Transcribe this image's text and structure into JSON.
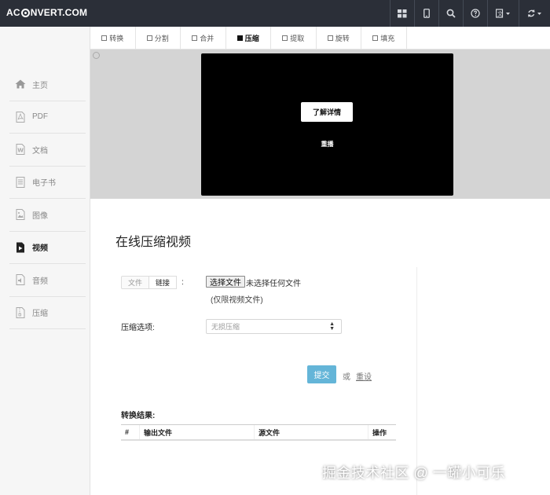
{
  "header": {
    "logo_left": "AC",
    "logo_right": "NVERT.COM"
  },
  "tabs": [
    {
      "label": "转换",
      "active": false
    },
    {
      "label": "分割",
      "active": false
    },
    {
      "label": "合并",
      "active": false
    },
    {
      "label": "压缩",
      "active": true
    },
    {
      "label": "提取",
      "active": false
    },
    {
      "label": "旋转",
      "active": false
    },
    {
      "label": "填充",
      "active": false
    }
  ],
  "sidebar": {
    "items": [
      {
        "label": "主页",
        "icon": "home-icon"
      },
      {
        "label": "PDF",
        "icon": "pdf-icon"
      },
      {
        "label": "文档",
        "icon": "document-icon"
      },
      {
        "label": "电子书",
        "icon": "ebook-icon"
      },
      {
        "label": "图像",
        "icon": "image-icon"
      },
      {
        "label": "视频",
        "icon": "video-icon",
        "active": true
      },
      {
        "label": "音频",
        "icon": "audio-icon"
      },
      {
        "label": "压缩",
        "icon": "archive-icon"
      }
    ]
  },
  "preview": {
    "learn_more": "了解详情",
    "replay": "重播"
  },
  "main": {
    "title": "在线压缩视频",
    "source": {
      "file": "文件",
      "link": "链接",
      "colon": ":"
    },
    "choose_button": "选择文件",
    "no_file": "未选择任何文件",
    "video_only": "(仅限视频文件)",
    "compress_label": "压缩选项:",
    "compress_value": "无损压缩",
    "submit": "提交",
    "or": "或",
    "reset": "重设",
    "results_label": "转换结果:",
    "results_columns": [
      "#",
      "输出文件",
      "源文件",
      "操作"
    ]
  },
  "watermark": "掘金技术社区 @ 一罐小可乐"
}
